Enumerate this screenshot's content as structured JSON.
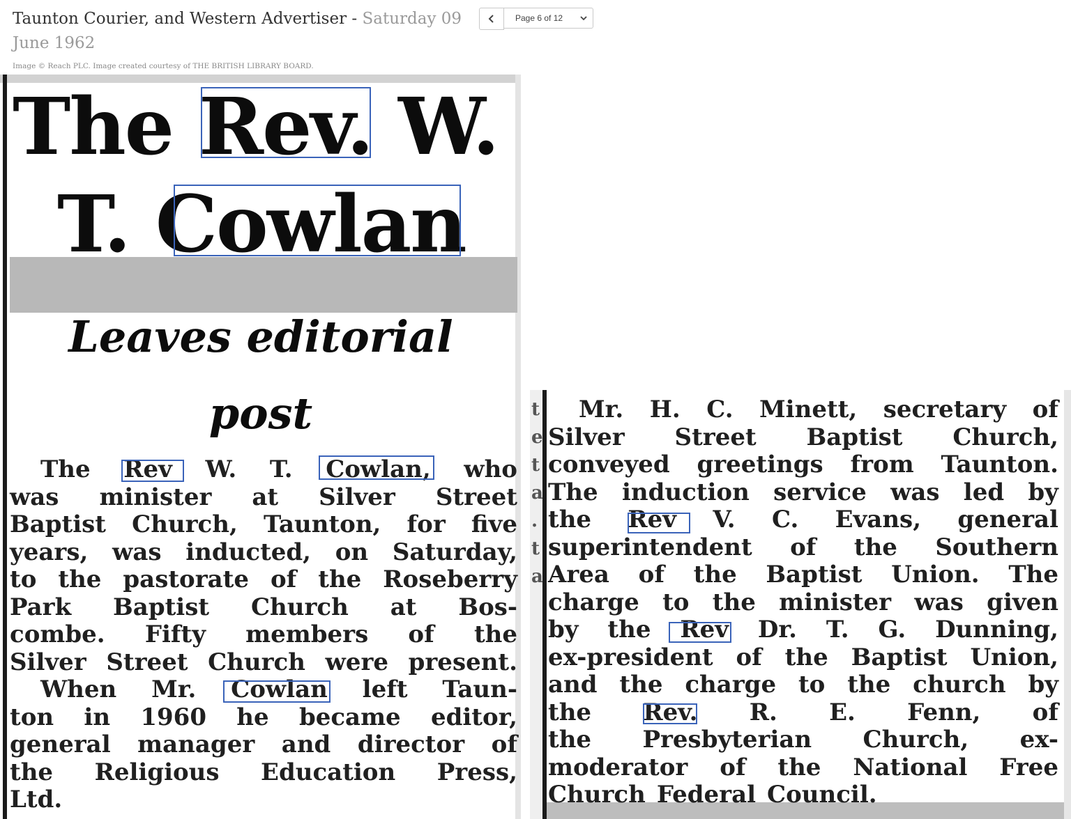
{
  "header": {
    "title": "Taunton Courier, and Western Advertiser",
    "separator": " - ",
    "date": "Saturday 09 June 1962",
    "credit": "Image © Reach PLC. Image created courtesy of THE BRITISH LIBRARY BOARD."
  },
  "pager": {
    "prev_icon": "chevron-left-icon",
    "page_label": "Page 6 of 12",
    "dropdown_icon": "chevron-down-icon"
  },
  "article": {
    "headline": [
      "The Rev. W.",
      "T. Cowlan"
    ],
    "subheadline": [
      "Leaves editorial",
      "post"
    ],
    "column1": [
      "The Rev W. T. Cowlan, who",
      "was minister at Silver Street",
      "Baptist Church, Taunton, for five",
      "years, was inducted, on Saturday,",
      "to the pastorate of the Roseberry",
      "Park Baptist Church at Bos-",
      "combe. Fifty members of the",
      "Silver Street Church were present.",
      "When Mr. Cowlan left Taun-",
      "ton in 1960 he became editor,",
      "general manager and director of",
      "the Religious Education Press,",
      "Ltd."
    ],
    "column2": [
      "Mr. H. C. Minett, secretary of",
      "Silver Street Baptist Church,",
      "conveyed greetings from Taunton.",
      "The induction service was led by",
      "the Rev V. C. Evans, general",
      "superintendent of the Southern",
      "Area of the Baptist Union. The",
      "charge to the minister was given",
      "by the Rev Dr. T. G. Dunning,",
      "ex-president of the Baptist Union,",
      "and the charge to the church by",
      "the Rev. R. E. Fenn, of",
      "the Presbyterian Church, ex-",
      "moderator of the National Free",
      "Church Federal Council."
    ],
    "column2_edge": [
      "t",
      "e",
      "t",
      "a",
      "",
      "",
      "",
      "",
      "",
      "",
      "",
      ".",
      "",
      "t",
      "a"
    ]
  },
  "colors": {
    "highlight": "#3a63b9",
    "title_text": "#333333",
    "date_text": "#9a9a9a"
  }
}
